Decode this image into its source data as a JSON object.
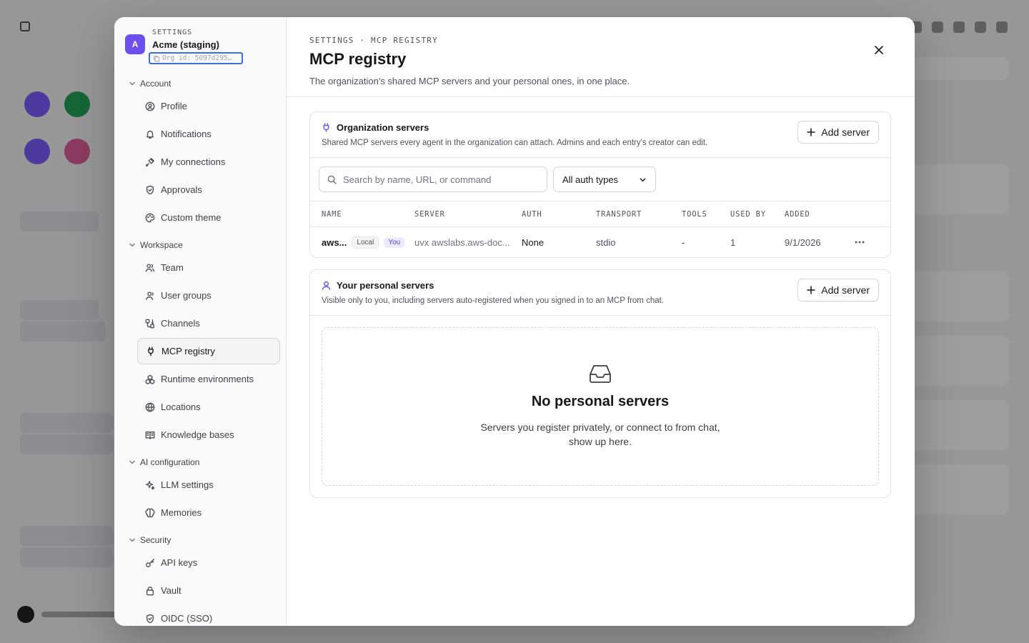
{
  "settings": {
    "kicker": "SETTINGS",
    "org_avatar": "A",
    "org_name": "Acme (staging)",
    "org_id": "Org id: 5097d295…",
    "sections": [
      {
        "label": "Account",
        "items": [
          {
            "label": "Profile",
            "icon": "user-circle-icon"
          },
          {
            "label": "Notifications",
            "icon": "bell-icon"
          },
          {
            "label": "My connections",
            "icon": "plug-connection-icon"
          },
          {
            "label": "Approvals",
            "icon": "shield-check-icon"
          },
          {
            "label": "Custom theme",
            "icon": "palette-icon"
          }
        ]
      },
      {
        "label": "Workspace",
        "items": [
          {
            "label": "Team",
            "icon": "users-icon"
          },
          {
            "label": "User groups",
            "icon": "user-group-icon"
          },
          {
            "label": "Channels",
            "icon": "channels-icon"
          },
          {
            "label": "MCP registry",
            "icon": "plug-icon",
            "active": true
          },
          {
            "label": "Runtime environments",
            "icon": "boxes-icon"
          },
          {
            "label": "Locations",
            "icon": "globe-icon"
          },
          {
            "label": "Knowledge bases",
            "icon": "book-icon"
          }
        ]
      },
      {
        "label": "AI configuration",
        "items": [
          {
            "label": "LLM settings",
            "icon": "sparkles-icon"
          },
          {
            "label": "Memories",
            "icon": "brain-icon"
          }
        ]
      },
      {
        "label": "Security",
        "items": [
          {
            "label": "API keys",
            "icon": "key-icon"
          },
          {
            "label": "Vault",
            "icon": "lock-icon"
          },
          {
            "label": "OIDC (SSO)",
            "icon": "shield-check-icon"
          }
        ]
      }
    ]
  },
  "header": {
    "breadcrumb": "SETTINGS · MCP REGISTRY",
    "title": "MCP registry",
    "description": "The organization's shared MCP servers and your personal ones, in one place."
  },
  "org_servers": {
    "title": "Organization servers",
    "description": "Shared MCP servers every agent in the organization can attach. Admins and each entry's creator can edit.",
    "add_label": "Add server",
    "search_placeholder": "Search by name, URL, or command",
    "auth_filter": "All auth types",
    "columns": [
      "NAME",
      "SERVER",
      "AUTH",
      "TRANSPORT",
      "TOOLS",
      "USED BY",
      "ADDED"
    ],
    "rows": [
      {
        "name": "aws...",
        "badges": [
          "Local",
          "You"
        ],
        "server": "uvx awslabs.aws-doc...",
        "auth": "None",
        "transport": "stdio",
        "tools": "-",
        "used_by": "1",
        "added": "9/1/2026"
      }
    ]
  },
  "personal_servers": {
    "title": "Your personal servers",
    "description": "Visible only to you, including servers auto-registered when you signed in to an MCP from chat.",
    "add_label": "Add server",
    "empty_title": "No personal servers",
    "empty_text": "Servers you register privately, or connect to from chat, show up here."
  },
  "colors": {
    "accent": "#6d4ff0",
    "focus_ring": "#3b6fe0",
    "badge_you_bg": "#ede9fe"
  }
}
